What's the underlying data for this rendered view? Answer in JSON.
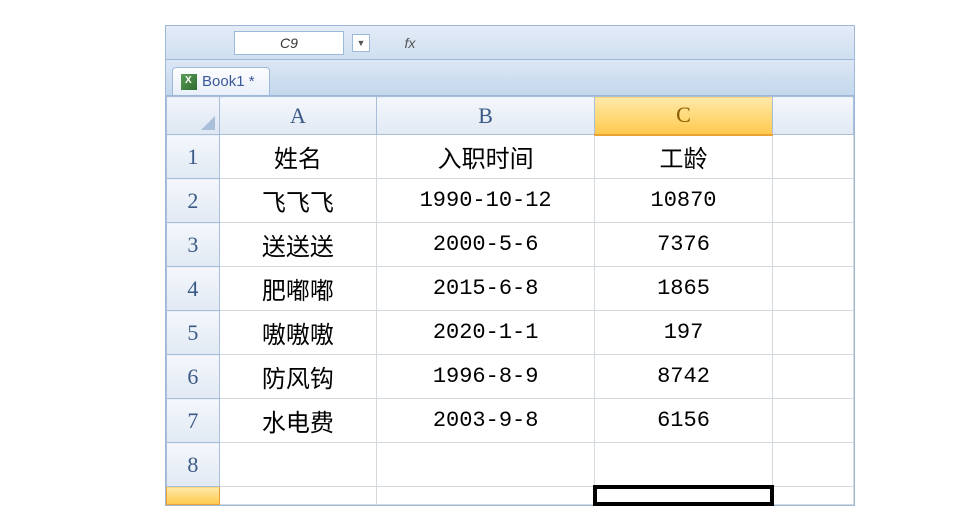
{
  "nameBox": "C9",
  "fxLabel": "fx",
  "workbookTab": "Book1 *",
  "columns": [
    "A",
    "B",
    "C"
  ],
  "selectedColumn": "C",
  "rows": [
    {
      "n": 1,
      "a": "姓名",
      "b": "入职时间",
      "c": "工龄"
    },
    {
      "n": 2,
      "a": "飞飞飞",
      "b": "1990-10-12",
      "c": "10870"
    },
    {
      "n": 3,
      "a": "送送送",
      "b": "2000-5-6",
      "c": "7376"
    },
    {
      "n": 4,
      "a": "肥嘟嘟",
      "b": "2015-6-8",
      "c": "1865"
    },
    {
      "n": 5,
      "a": "嗷嗷嗷",
      "b": "2020-1-1",
      "c": "197"
    },
    {
      "n": 6,
      "a": "防风钩",
      "b": "1996-8-9",
      "c": "8742"
    },
    {
      "n": 7,
      "a": "水电费",
      "b": "2003-9-8",
      "c": "6156"
    },
    {
      "n": 8,
      "a": "",
      "b": "",
      "c": ""
    }
  ],
  "selectedCell": {
    "row": 9,
    "col": "C"
  }
}
